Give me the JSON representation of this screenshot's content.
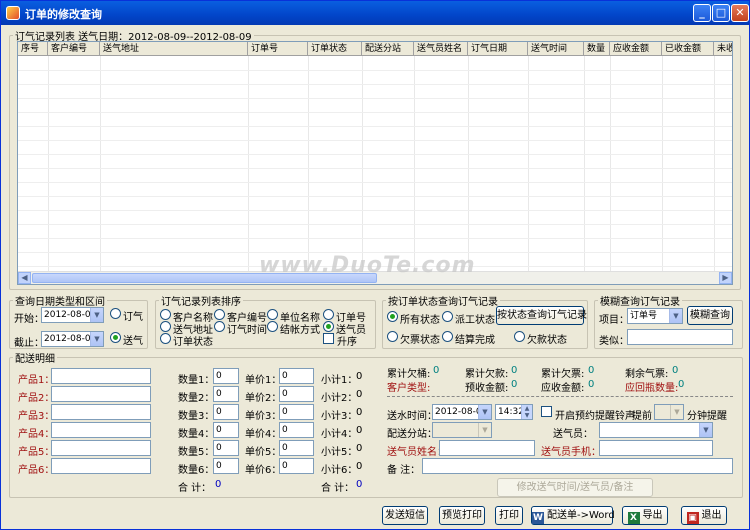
{
  "window": {
    "title": "订单的修改查询",
    "min": "_",
    "max": "□",
    "close": "✕"
  },
  "records": {
    "legend": "订气记录列表  送气日期：2012-08-09--2012-08-09",
    "columns": [
      "序号",
      "客户编号",
      "送气地址",
      "订单号",
      "订单状态",
      "配送分站",
      "送气员姓名",
      "订气日期",
      "送气时间",
      "数量",
      "应收金额",
      "已收金额",
      "未收"
    ]
  },
  "date_type": {
    "legend": "查询日期类型和区间",
    "start_label": "开始：",
    "start_value": "2012-08-09",
    "end_label": "截止：",
    "end_value": "2012-08-09",
    "opt_order": "订气",
    "opt_delivery": "送气"
  },
  "sort": {
    "legend": "订气记录列表排序",
    "options": [
      "客户名称",
      "客户编号",
      "单位名称",
      "订单号",
      "送气地址",
      "订气时间",
      "结帐方式",
      "送气员",
      "订单状态"
    ],
    "asc_label": "升序"
  },
  "status_query": {
    "legend": "按订单状态查询订气记录",
    "options": [
      "所有状态",
      "派工状态",
      "欠票状态",
      "结算完成",
      "欠款状态"
    ],
    "button": "按状态查询订气记录"
  },
  "fuzzy": {
    "legend": "模糊查询订气记录",
    "item_label": "项目：",
    "item_value": "订单号",
    "button": "模糊查询",
    "kind_label": "类似："
  },
  "detail": {
    "legend": "配送明细",
    "products": [
      "产品1：",
      "产品2：",
      "产品3：",
      "产品4：",
      "产品5：",
      "产品6："
    ],
    "qty_labels": [
      "数量1：",
      "数量2：",
      "数量3：",
      "数量4：",
      "数量5：",
      "数量6："
    ],
    "qty_values": [
      "0",
      "0",
      "0",
      "0",
      "0",
      "0"
    ],
    "price_labels": [
      "单价1：",
      "单价2：",
      "单价3：",
      "单价4：",
      "单价5：",
      "单价6："
    ],
    "price_values": [
      "0",
      "0",
      "0",
      "0",
      "0",
      "0"
    ],
    "subtotal_labels": [
      "小计1：",
      "小计2：",
      "小计3：",
      "小计4：",
      "小计5：",
      "小计6："
    ],
    "subtotal_values": [
      "0",
      "0",
      "0",
      "0",
      "0",
      "0"
    ],
    "total_qty_label": "合 计：",
    "total_qty_value": "0",
    "total_amt_label": "合 计：",
    "total_amt_value": "0"
  },
  "summary": {
    "owed_bottles_label": "累计欠桶:",
    "owed_bottles_value": "0",
    "owed_money_label": "累计欠款:",
    "owed_money_value": "0",
    "owed_ticket_label": "累计欠票:",
    "owed_ticket_value": "0",
    "remain_ticket_label": "剩余气票:",
    "remain_ticket_value": "0",
    "cust_type_label": "客户类型:",
    "prepaid_label": "预收金额:",
    "prepaid_value": "0",
    "receivable_label": "应收金额:",
    "receivable_value": "0",
    "return_label": "应回瓶数量:",
    "return_value": "0"
  },
  "delivery": {
    "time_label": "送水时间：",
    "date_value": "2012-08-09",
    "time_value": "14:32",
    "remind_label": "开启预约提醒铃声",
    "ahead_label": "提前",
    "minute_label": "分钟提醒",
    "station_label": "配送分站：",
    "courier_label": "送气员：",
    "courier_name_label": "送气员姓名：",
    "courier_phone_label": "送气员手机：",
    "note_label": "备 注：",
    "modify_button": "修改送气时间/送气员/备注"
  },
  "footer": {
    "sms": "发送短信",
    "preview": "预览打印",
    "print": "打印",
    "word": "配送单->Word",
    "export": "导出",
    "exit": "退出"
  },
  "watermark": "www.DuoTe.com",
  "colors": {
    "accent": "#0245c9",
    "red_label": "#a01010",
    "value_teal": "#008080"
  }
}
